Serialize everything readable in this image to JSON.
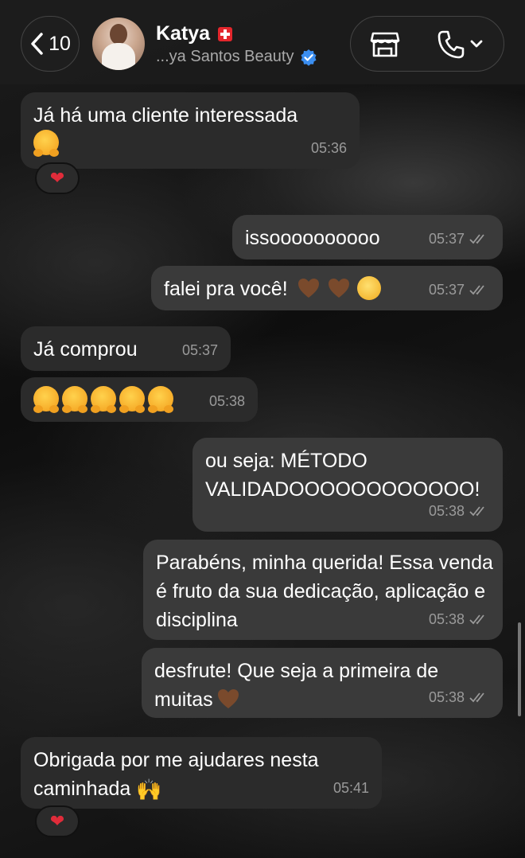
{
  "header": {
    "back_count": "10",
    "contact_name": "Katya",
    "contact_subtitle": "...ya Santos Beauty"
  },
  "messages": [
    {
      "direction": "in",
      "text": "Já há uma cliente interessada",
      "emoji": "hugging-face",
      "time": "05:36",
      "reaction": "❤"
    },
    {
      "direction": "out",
      "text": "issoooooooooo",
      "time": "05:37"
    },
    {
      "direction": "out",
      "text": "falei pra você!",
      "emoji": "brown-heart brown-heart pleading-face",
      "time": "05:37"
    },
    {
      "direction": "in",
      "text": "Já comprou",
      "time": "05:37"
    },
    {
      "direction": "in",
      "text": "",
      "emoji": "hugging-face x5",
      "time": "05:38"
    },
    {
      "direction": "out",
      "text": "ou seja: MÉTODO VALIDADOOOOOOOOOOOO!",
      "time": "05:38"
    },
    {
      "direction": "out",
      "text": "Parabéns, minha querida! Essa venda é fruto da sua dedicação, aplicação e disciplina",
      "time": "05:38"
    },
    {
      "direction": "out",
      "text": "desfrute! Que seja a primeira de muitas",
      "emoji": "brown-heart",
      "time": "05:38"
    },
    {
      "direction": "in",
      "text": "Obrigada por me ajudares nesta caminhada",
      "emoji": "raising-hands",
      "time": "05:41",
      "reaction": "❤"
    }
  ],
  "colors": {
    "incoming_bubble": "#2b2b2b",
    "outgoing_bubble": "#3a3a3a",
    "verified_badge": "#3b8ef0",
    "swiss_flag": "#e3262c"
  }
}
